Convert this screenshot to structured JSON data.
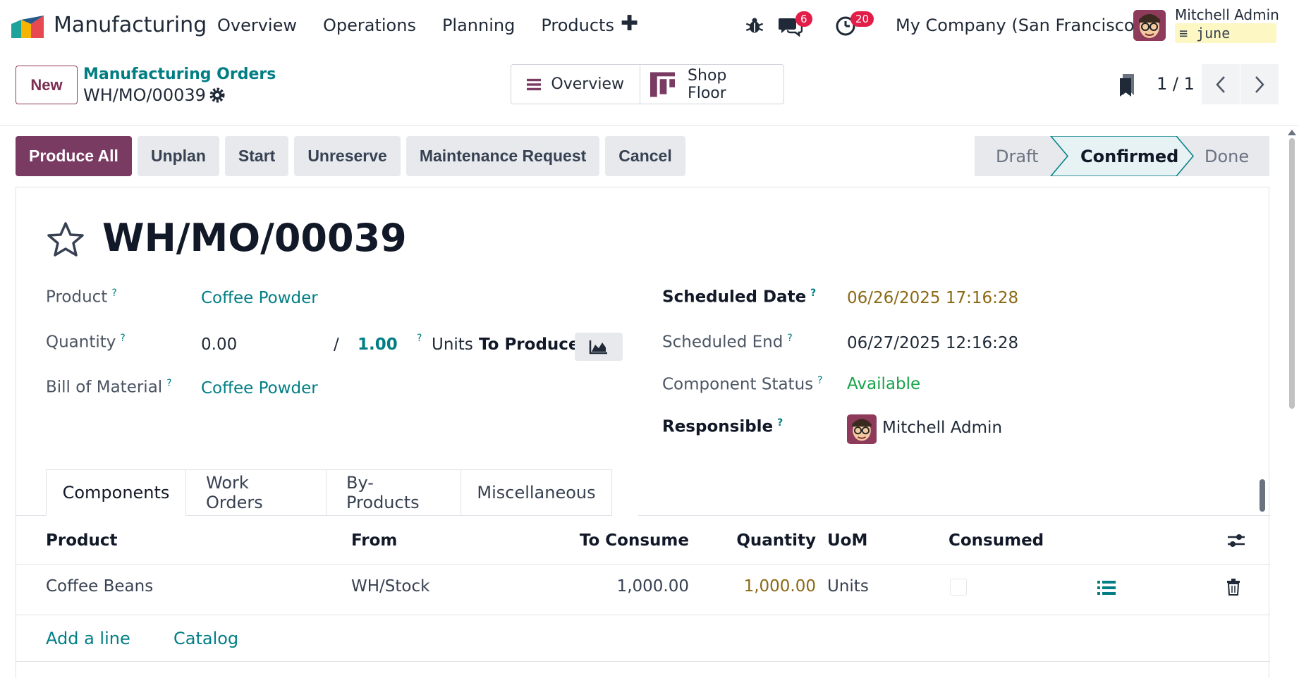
{
  "navbar": {
    "app_name": "Manufacturing",
    "menu": [
      "Overview",
      "Operations",
      "Planning",
      "Products"
    ],
    "plus": "✚",
    "messages_count": "6",
    "activities_count": "20",
    "company": "My Company (San Francisco)",
    "user_name": "Mitchell Admin",
    "database": "june"
  },
  "control": {
    "new_label": "New",
    "breadcrumb_parent": "Manufacturing Orders",
    "breadcrumb_current": "WH/MO/00039",
    "view_overview": "Overview",
    "view_shop_floor": "Shop Floor",
    "pager": "1 / 1"
  },
  "actions": [
    "Produce All",
    "Unplan",
    "Start",
    "Unreserve",
    "Maintenance Request",
    "Cancel"
  ],
  "stages": [
    "Draft",
    "Confirmed",
    "Done"
  ],
  "form": {
    "title": "WH/MO/00039",
    "product_label": "Product",
    "product_value": "Coffee Powder",
    "quantity_label": "Quantity",
    "quantity_produced": "0.00",
    "quantity_sep": "/",
    "quantity_total": "1.00",
    "quantity_unit": "Units",
    "quantity_to_produce": "To Produce",
    "bom_label": "Bill of Material",
    "bom_value": "Coffee Powder",
    "scheduled_date_label": "Scheduled Date",
    "scheduled_date_value": "06/26/2025 17:16:28",
    "scheduled_end_label": "Scheduled End",
    "scheduled_end_value": "06/27/2025 12:16:28",
    "component_status_label": "Component Status",
    "component_status_value": "Available",
    "responsible_label": "Responsible",
    "responsible_value": "Mitchell Admin",
    "help_mark": "?"
  },
  "tabs": [
    "Components",
    "Work Orders",
    "By-Products",
    "Miscellaneous"
  ],
  "table": {
    "headers": {
      "product": "Product",
      "from": "From",
      "to_consume": "To Consume",
      "quantity": "Quantity",
      "uom": "UoM",
      "consumed": "Consumed"
    },
    "rows": [
      {
        "product": "Coffee Beans",
        "from": "WH/Stock",
        "to_consume": "1,000.00",
        "quantity": "1,000.00",
        "uom": "Units"
      }
    ],
    "add_line": "Add a line",
    "catalog": "Catalog"
  },
  "colors": {
    "primary": "#7a3b63",
    "link": "#017e84",
    "date": "#8b6914",
    "available": "#16a34a",
    "badge": "#e11d48"
  }
}
